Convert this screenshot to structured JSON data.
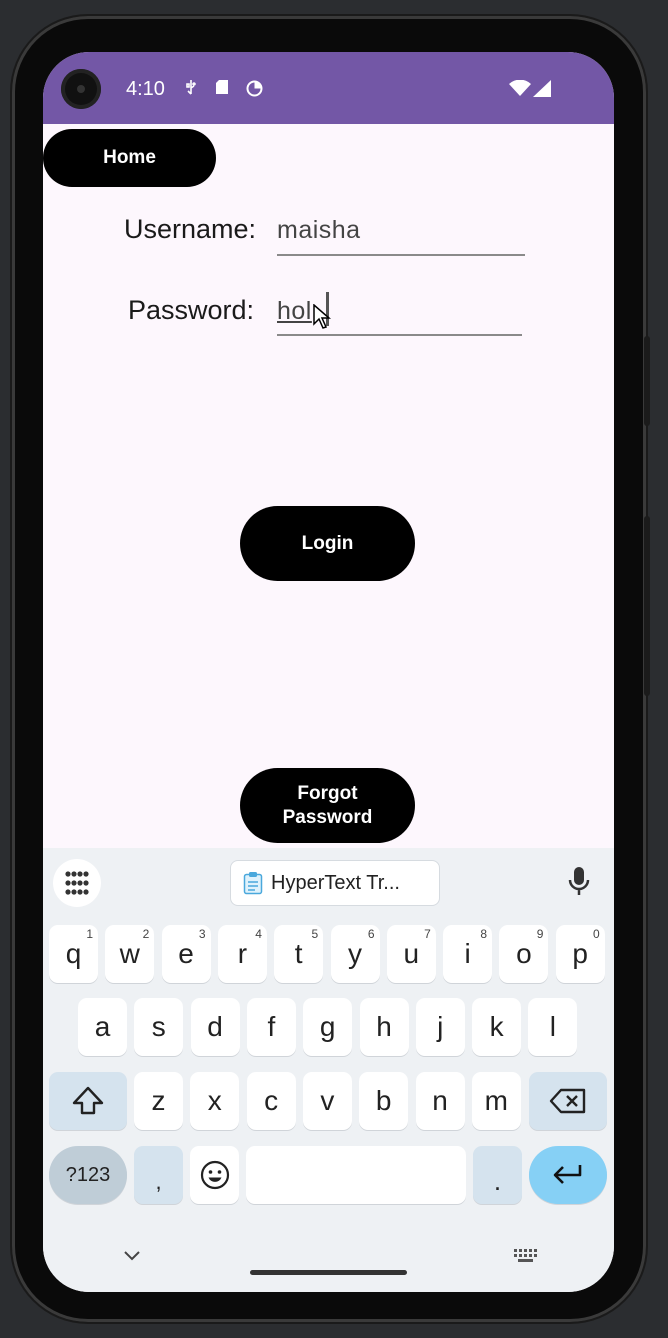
{
  "status_bar": {
    "time": "4:10"
  },
  "app": {
    "home_button": "Home",
    "username_label": "Username:",
    "username_value": "maisha",
    "password_label": "Password:",
    "password_value": "hol",
    "login_button": "Login",
    "forgot_button_line1": "Forgot",
    "forgot_button_line2": "Password"
  },
  "keyboard": {
    "clipboard_chip": "HyperText Tr...",
    "row1": [
      "q",
      "w",
      "e",
      "r",
      "t",
      "y",
      "u",
      "i",
      "o",
      "p"
    ],
    "row1_hints": [
      "1",
      "2",
      "3",
      "4",
      "5",
      "6",
      "7",
      "8",
      "9",
      "0"
    ],
    "row2": [
      "a",
      "s",
      "d",
      "f",
      "g",
      "h",
      "j",
      "k",
      "l"
    ],
    "row3": [
      "z",
      "x",
      "c",
      "v",
      "b",
      "n",
      "m"
    ],
    "symbols_key": "?123",
    "comma_key": ",",
    "period_key": "."
  },
  "colors": {
    "status_bar": "#7357a6",
    "app_background": "#fdf7fd",
    "enter_key": "#86d0f5"
  }
}
